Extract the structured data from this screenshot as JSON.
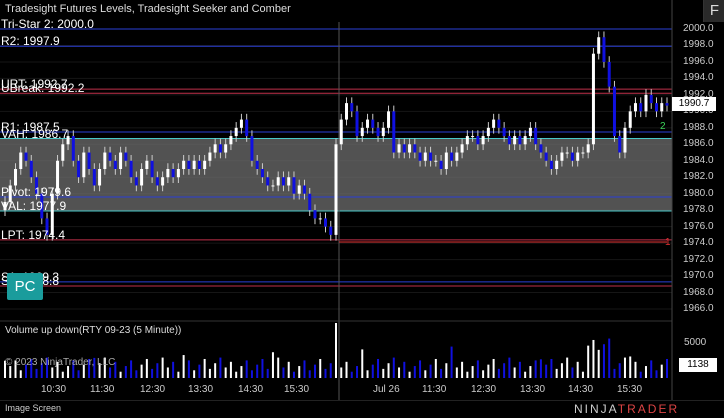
{
  "header": {
    "title": "Tradesight Futures Levels, Tradesight Seeker and Comber",
    "float_button": "F"
  },
  "levels": [
    {
      "label": "Tri-Star 2: 2000.0",
      "value": 2000.0,
      "color": "#2a3fd6"
    },
    {
      "label": "R2: 1997.9",
      "value": 1997.9,
      "color": "#2a3fd6"
    },
    {
      "label": "URT: 1992.7",
      "value": 1992.7,
      "color": "#c0304a"
    },
    {
      "label": "UBreak: 1992.2",
      "value": 1992.2,
      "color": "#c0304a"
    },
    {
      "label": "R1: 1987.5",
      "value": 1987.5,
      "color": "#2a3fd6"
    },
    {
      "label": "VAH: 1986.7",
      "value": 1986.7,
      "color": "#48c9c9"
    },
    {
      "label": "Pivot: 1979.6",
      "value": 1979.6,
      "color": "#2a3fd6"
    },
    {
      "label": "VAL: 1977.9",
      "value": 1977.9,
      "color": "#48c9c9"
    },
    {
      "label": "LPT: 1974.4",
      "value": 1974.4,
      "color": "#c0304a"
    },
    {
      "label": "S1: 1969.3",
      "value": 1969.3,
      "color": "#2a3fd6"
    },
    {
      "label": "S2: 1968.8",
      "value": 1968.8,
      "color": "#c0304a"
    }
  ],
  "value_area": {
    "high": 1986.7,
    "low": 1977.9
  },
  "pc_badge": "PC",
  "price_axis": {
    "ticks": [
      "2000.0",
      "1998.0",
      "1996.0",
      "1994.0",
      "1992.0",
      "1990.0",
      "1988.0",
      "1986.0",
      "1984.0",
      "1982.0",
      "1980.0",
      "1978.0",
      "1976.0",
      "1974.0",
      "1972.0",
      "1970.0",
      "1968.0",
      "1966.0"
    ],
    "last_price": "1990.7"
  },
  "markers": {
    "green": "2",
    "red": "1"
  },
  "time_axis": {
    "ticks": [
      "10:30",
      "11:30",
      "12:30",
      "13:30",
      "14:30",
      "15:30",
      "Jul 26",
      "11:30",
      "12:30",
      "13:30",
      "14:30",
      "15:30"
    ]
  },
  "volume_panel": {
    "title": "Volume up down(RTY 09-23 (5 Minute))",
    "tick": "5000",
    "last_volume": "1138"
  },
  "copyright": "© 2023 NinjaTrader, LLC",
  "footer": {
    "tab": "Image Screen",
    "brand_left": "NINJA",
    "brand_right": "TRADER"
  },
  "chart_data": {
    "type": "candlestick",
    "ylim": [
      1965,
      2001.5
    ],
    "close": [
      1979,
      1981,
      1983,
      1985,
      1984,
      1982,
      1980,
      1977,
      1975,
      1980,
      1984,
      1986,
      1987,
      1984,
      1982,
      1985,
      1983,
      1981,
      1983,
      1985,
      1984,
      1983,
      1985,
      1984,
      1982,
      1981,
      1983,
      1984,
      1982,
      1981,
      1982,
      1983,
      1982,
      1983,
      1984,
      1983,
      1984,
      1983,
      1984,
      1985,
      1986,
      1985,
      1986,
      1987,
      1988,
      1989,
      1987,
      1984,
      1983,
      1982,
      1981,
      1981,
      1982,
      1981,
      1982,
      1980,
      1981,
      1980,
      1978,
      1977,
      1977,
      1976,
      1975,
      1986,
      1989,
      1991,
      1990,
      1987,
      1988,
      1989,
      1988,
      1987,
      1988,
      1990,
      1985,
      1986,
      1985,
      1986,
      1985,
      1984,
      1985,
      1984,
      1984,
      1983,
      1985,
      1984,
      1985,
      1986,
      1987,
      1987,
      1986,
      1987,
      1988,
      1989,
      1988,
      1987,
      1986,
      1987,
      1986,
      1987,
      1988,
      1986,
      1985,
      1984,
      1983,
      1984,
      1985,
      1985,
      1984,
      1985,
      1985,
      1986,
      1997,
      1999,
      1996,
      1993,
      1987,
      1985,
      1988,
      1990,
      1991,
      1990,
      1992,
      1991,
      1990,
      1991,
      1990.7
    ],
    "volume_max": 7000
  }
}
